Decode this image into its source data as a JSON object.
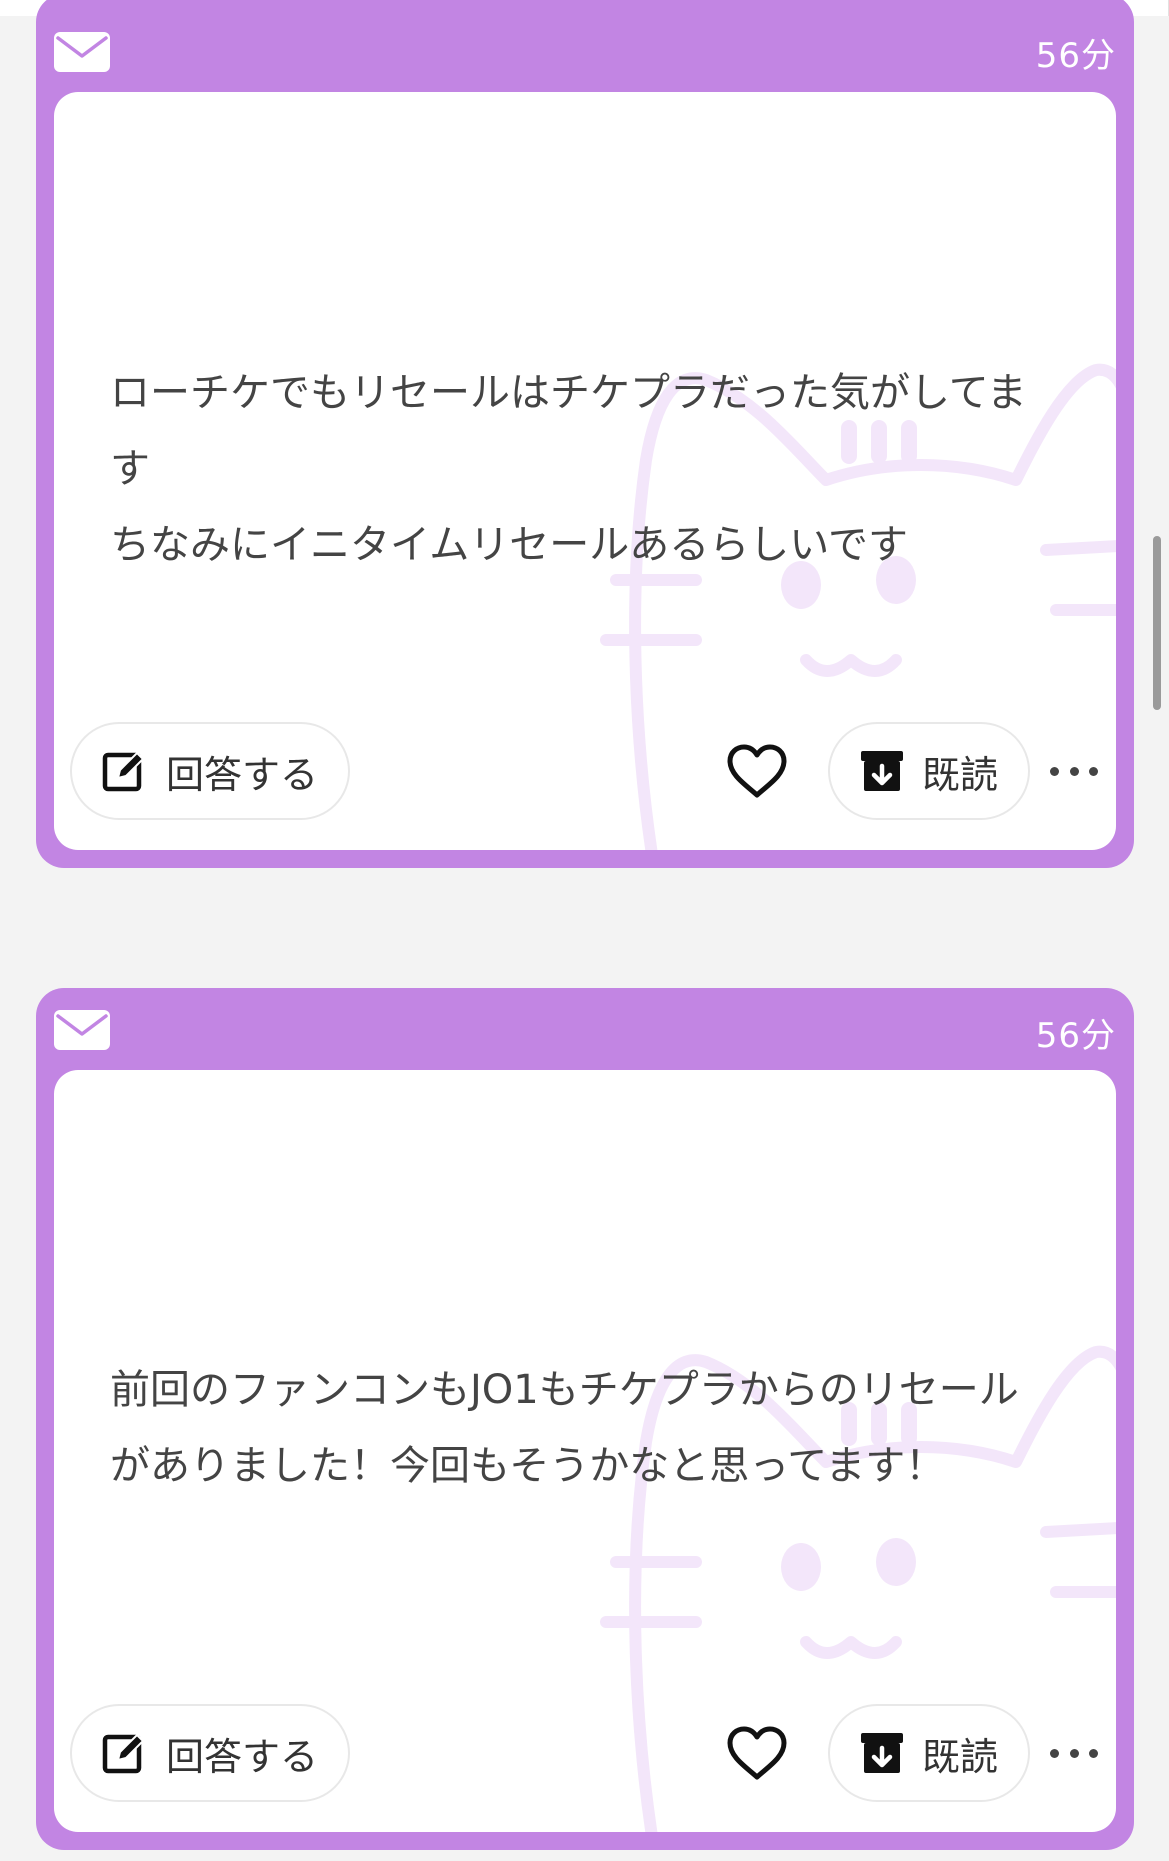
{
  "theme": {
    "card_color": "#c285e3",
    "body_color": "#ffffff",
    "watermark_color": "#f3e6fa",
    "page_bg": "#f3f3f3"
  },
  "messages": [
    {
      "time": "56分",
      "text": "ローチケでもリセールはチケプラだった気がしてます\nちなみにイニタイムリセールあるらしいです",
      "answer_label": "回答する",
      "read_label": "既読",
      "icons": [
        "mail-icon",
        "edit-icon",
        "heart-icon",
        "archive-icon",
        "more-icon"
      ]
    },
    {
      "time": "56分",
      "text": "前回のファンコンもJO1もチケプラからのリセールがありました！今回もそうかなと思ってます！",
      "answer_label": "回答する",
      "read_label": "既読",
      "icons": [
        "mail-icon",
        "edit-icon",
        "heart-icon",
        "archive-icon",
        "more-icon"
      ]
    }
  ]
}
